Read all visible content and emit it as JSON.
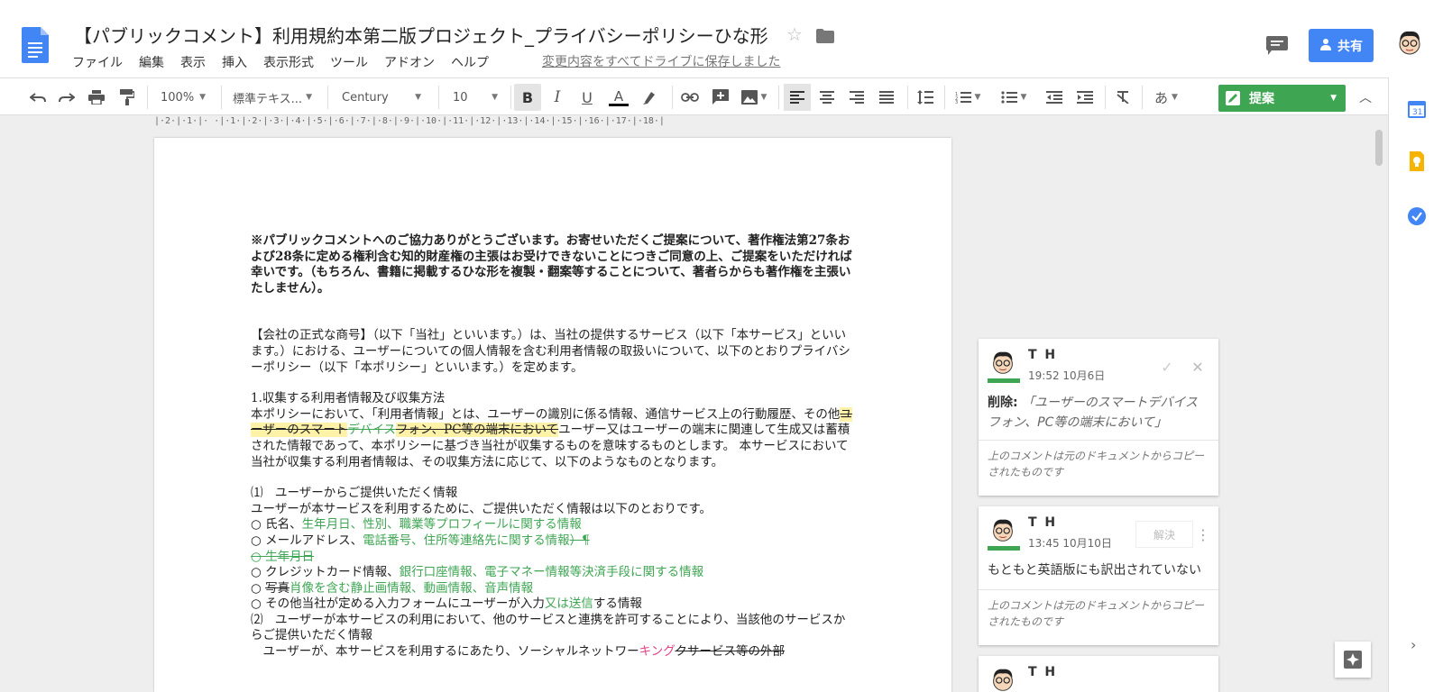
{
  "header": {
    "title": "【パブリックコメント】利用規約本第二版プロジェクト_プライバシーポリシーひな形",
    "save_status": "変更内容をすべてドライブに保存しました",
    "share_label": "共有",
    "accent": "#4285f4"
  },
  "menu": [
    "ファイル",
    "編集",
    "表示",
    "挿入",
    "表示形式",
    "ツール",
    "アドオン",
    "ヘルプ"
  ],
  "toolbar": {
    "zoom": "100%",
    "style": "標準テキス...",
    "font": "Century",
    "size": "10",
    "input_mode": "あ",
    "suggest_label": "提案",
    "suggest_color": "#3ea653"
  },
  "ruler": "|·2·|·1·|·   ·|·1·|·2·|·3·|·4·|·5·|·6·|·7·|·8·|·9·|·10·|·11·|·12·|·13·|·14·|·15·|·16·|·17·|·18·|",
  "document": {
    "notice": "※パブリックコメントへのご協力ありがとうございます。お寄せいただくご提案について、著作権法第27条および28条に定める権利含む知的財産権の主張はお受けできないことにつきご同意の上、ご提案をいただければ幸いです。（もちろん、書籍に掲載するひな形を複製・翻案等することについて、著者らからも著作権を主張いたしません）。",
    "intro": "【会社の正式な商号】（以下「当社」といいます。）は、当社の提供するサービス（以下「本サービス」といいます。）における、ユーザーについての個人情報を含む利用者情報の取扱いについて、以下のとおりプライバシーポリシー（以下「本ポリシー」といいます。）を定めます。",
    "s1_heading": "1.収集する利用者情報及び収集方法",
    "s1_pre": "本ポリシーにおいて、「利用者情報」とは、ユーザーの識別に係る情報、通信サービス上の行動履歴、その他",
    "s1_del1": "ユーザーのスマート",
    "s1_del2": "デバイス",
    "s1_del3": "フォン、PC等の端末において",
    "s1_post": "ユーザー又はユーザーの端末に関連して生成又は蓄積された情報であって、本ポリシーに基づき当社が収集するものを意味するものとします。 本サービスにおいて当社が収集する利用者情報は、その収集方法に応じて、以下のようなものとなります。",
    "sub1_heading": "⑴　ユーザーからご提供いただく情報",
    "sub1_intro": "ユーザーが本サービスを利用するために、ご提供いただく情報は以下のとおりです。",
    "item1_a": "○ 氏名、",
    "item1_b": "生年月日、性別、職業等プロフィールに関する情報",
    "item2_a": "○ メールアドレス、",
    "item2_b": "電話番号、住所等連絡先に関する情報",
    "item2_c": "）¶",
    "item3": "○ 生年月日",
    "item4_a": "○ クレジットカード情報、",
    "item4_b": "銀行口座情報、電子マネー情報等決済手段に関する情報",
    "item5_a": "○ ",
    "item5_b": "写真",
    "item5_c": "肖像を含む静止画情報、動画情報、音声情報",
    "item6_a": "○ その他当社が定める入力フォームにユーザーが入力",
    "item6_b": "又は送信",
    "item6_c": "する情報",
    "sub2_heading": "⑵　ユーザーが本サービスの利用において、他のサービスと連携を許可することにより、当該他のサービスからご提供いただく情報",
    "sub2_body_a": "　ユーザーが、本サービスを利用するにあたり、ソーシャルネットワー",
    "sub2_body_b": "キング",
    "sub2_body_c": "クサービス等の外部"
  },
  "comments": [
    {
      "author": "T H",
      "time": "19:52 10月6日",
      "label": "削除:",
      "quote": "「ユーザーのスマートデバイスフォン、PC等の端末において」",
      "footer": "上のコメントは元のドキュメントからコピーされたものです"
    },
    {
      "author": "T H",
      "time": "13:45 10月10日",
      "resolve": "解決",
      "text": "もともと英語版にも訳出されていない",
      "footer": "上のコメントは元のドキュメントからコピーされたものです"
    },
    {
      "author": "T H"
    }
  ]
}
